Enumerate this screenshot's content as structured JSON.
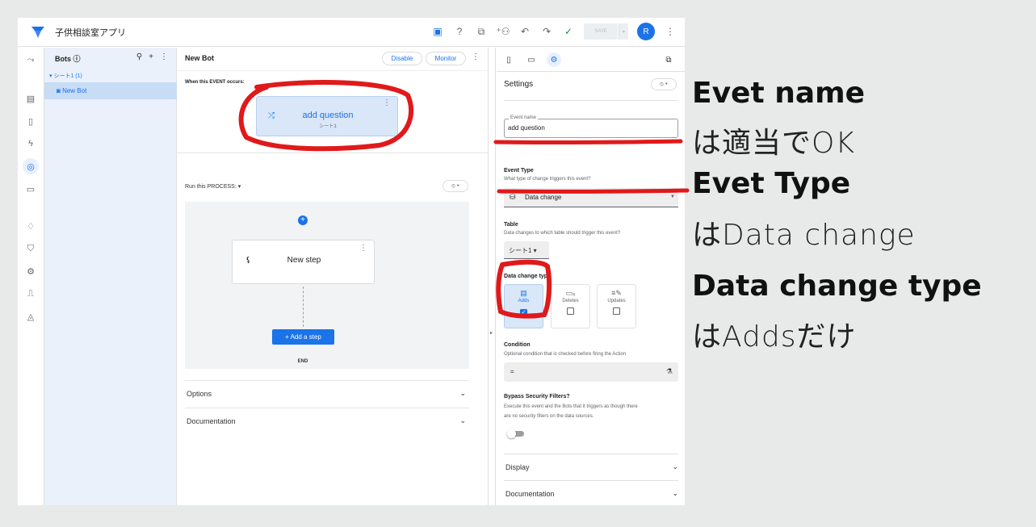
{
  "app": {
    "title": "子供相談室アプリ"
  },
  "topbar": {
    "save_label": "SAVE",
    "avatar_letter": "R"
  },
  "bots_panel": {
    "title": "Bots ⓘ",
    "group": "▾ シート1 (1)",
    "item": "New Bot"
  },
  "center": {
    "title": "New Bot",
    "disable_label": "Disable",
    "monitor_label": "Monitor",
    "when_label": "When this EVENT occurs:",
    "event_name": "add question",
    "event_sub": "シート1",
    "run_label": "Run this PROCESS:",
    "step_name": "New step",
    "add_step_label": "+  Add a step",
    "end_label": "END",
    "options_label": "Options",
    "documentation_label": "Documentation"
  },
  "settings": {
    "title": "Settings",
    "event_name_label": "Event name",
    "event_name_value": "add question",
    "event_type_label": "Event Type",
    "event_type_desc": "What type of change triggers this event?",
    "event_type_value": "Data change",
    "table_label": "Table",
    "table_desc": "Data changes to which table should trigger this event?",
    "table_value": "シート1 ▾",
    "data_change_type_label": "Data change type",
    "change_types": [
      {
        "label": "Adds",
        "checked": true
      },
      {
        "label": "Deletes",
        "checked": false
      },
      {
        "label": "Updates",
        "checked": false
      }
    ],
    "condition_label": "Condition",
    "condition_desc": "Optional condition that is checked before firing the Action",
    "condition_value": "=",
    "bypass_label": "Bypass Security Filters?",
    "bypass_desc1": "Execute this event and the Bots that it triggers as though there",
    "bypass_desc2": "are no security filters on the data sources.",
    "display_label": "Display",
    "documentation_label": "Documentation"
  },
  "annotations": {
    "note1_head": "Evet name",
    "note1_sub": "は適当でOK",
    "note2_head": "Evet Type",
    "note2_sub": "はData change",
    "note3_head": "Data change type",
    "note3_sub": "はAddsだけ",
    "marker_color": "#e0191b"
  },
  "colors": {
    "accent": "#1a73e8",
    "selected_bg": "#d9e7f8",
    "panel_bg": "#eaf1fb"
  }
}
